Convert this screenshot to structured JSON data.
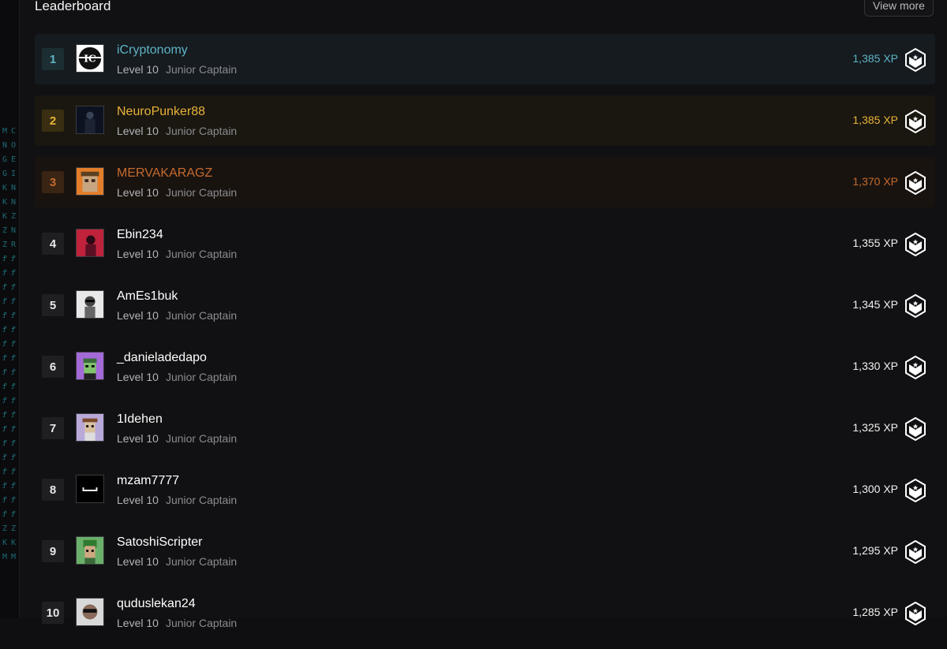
{
  "header": {
    "title": "Leaderboard",
    "view_more": "View more"
  },
  "sidebar_glyphs": {
    "col1": [
      "M",
      "N",
      "G",
      "G",
      "K",
      "K",
      "K",
      "Z",
      "Z",
      "Ꝭ",
      "Ꝭ",
      "Ꝭ",
      "Ꝭ",
      "Ꝭ",
      "Ꝭ",
      "Ꝭ",
      "Ꝭ",
      "Ꝭ",
      "Ꝭ",
      "Ꝭ",
      "Ꝭ",
      "Ꝭ",
      "Ꝭ",
      "Ꝭ",
      "Ꝭ",
      "Ꝭ",
      "Ꝭ",
      "Ꝭ",
      "Z",
      "K",
      "M"
    ],
    "col2": [
      "C",
      "O",
      "E",
      "I",
      "N",
      "N",
      "Z",
      "N",
      "R",
      "Ꝭ",
      "Ꝭ",
      "Ꝭ",
      "Ꝭ",
      "Ꝭ",
      "Ꝭ",
      "Ꝭ",
      "Ꝭ",
      "Ꝭ",
      "Ꝭ",
      "Ꝭ",
      "Ꝭ",
      "Ꝭ",
      "Ꝭ",
      "Ꝭ",
      "Ꝭ",
      "Ꝭ",
      "Ꝭ",
      "Ꝭ",
      "Z",
      "K",
      "M"
    ]
  },
  "colors": {
    "rank1": "#5fb3c6",
    "rank2": "#e8b23a",
    "rank3": "#c56a2f",
    "rank1_bg": "#151b1f",
    "rank2_bg": "#1a1710",
    "rank3_bg": "#19130f",
    "rank1_chip": "#1d2e32",
    "rank2_chip": "#3a2e12",
    "rank3_chip": "#3a2413"
  },
  "leaderboard": [
    {
      "rank": "1",
      "name": "iCryptonomy",
      "level": "Level 10",
      "title": "Junior Captain",
      "xp": "1,385 XP",
      "avatar": "ic-logo"
    },
    {
      "rank": "2",
      "name": "NeuroPunker88",
      "level": "Level 10",
      "title": "Junior Captain",
      "xp": "1,385 XP",
      "avatar": "dark-figure"
    },
    {
      "rank": "3",
      "name": "MERVAKARAGZ",
      "level": "Level 10",
      "title": "Junior Captain",
      "xp": "1,370 XP",
      "avatar": "sloth"
    },
    {
      "rank": "4",
      "name": "Ebin234",
      "level": "Level 10",
      "title": "Junior Captain",
      "xp": "1,355 XP",
      "avatar": "red-portrait"
    },
    {
      "rank": "5",
      "name": "AmEs1buk",
      "level": "Level 10",
      "title": "Junior Captain",
      "xp": "1,345 XP",
      "avatar": "bw-portrait"
    },
    {
      "rank": "6",
      "name": "_danieladedapo",
      "level": "Level 10",
      "title": "Junior Captain",
      "xp": "1,330 XP",
      "avatar": "pixel-purple"
    },
    {
      "rank": "7",
      "name": "1Idehen",
      "level": "Level 10",
      "title": "Junior Captain",
      "xp": "1,325 XP",
      "avatar": "pixel-cowboy"
    },
    {
      "rank": "8",
      "name": "mzam7777",
      "level": "Level 10",
      "title": "Junior Captain",
      "xp": "1,300 XP",
      "avatar": "black-face"
    },
    {
      "rank": "9",
      "name": "SatoshiScripter",
      "level": "Level 10",
      "title": "Junior Captain",
      "xp": "1,295 XP",
      "avatar": "pixel-green"
    },
    {
      "rank": "10",
      "name": "quduslekan24",
      "level": "Level 10",
      "title": "Junior Captain",
      "xp": "1,285 XP",
      "avatar": "sunglasses"
    }
  ]
}
